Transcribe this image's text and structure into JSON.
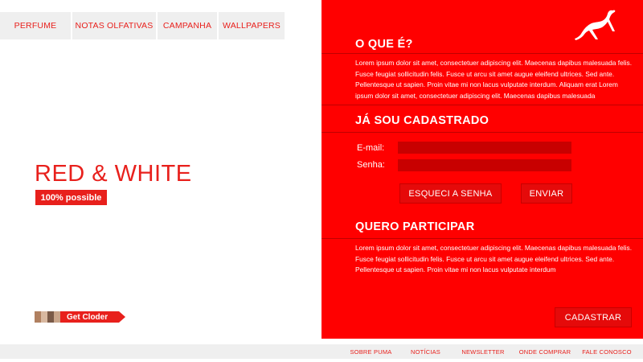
{
  "nav": {
    "items": [
      {
        "label": "PERFUME"
      },
      {
        "label": "NOTAS OLFATIVAS"
      },
      {
        "label": "CAMPANHA"
      },
      {
        "label": "WALLPAPERS"
      }
    ]
  },
  "hero": {
    "title": "RED & WHITE",
    "tagline": "100% possible"
  },
  "promo": {
    "label": "Get Cloder",
    "thumb_colors": [
      "#b08060",
      "#d8b8a0",
      "#7a5a48",
      "#c9a58a"
    ]
  },
  "panel": {
    "logo_icon": "puma-logo-icon",
    "about": {
      "title": "O QUE É?",
      "text": "Lorem ipsum dolor sit amet, consectetuer adipiscing elit. Maecenas dapibus malesuada felis. Fusce feugiat sollicitudin felis. Fusce ut arcu sit amet augue eleifend ultrices. Sed ante. Pellentesque ut sapien. Proin vitae mi non lacus  vulputate interdum. Aliquam erat Lorem ipsum dolor sit amet, consectetuer adipiscing elit. Maecenas dapibus malesuada"
    },
    "login": {
      "title": "JÁ SOU CADASTRADO",
      "email_label": "E-mail:",
      "email_value": "",
      "password_label": "Senha:",
      "password_value": "",
      "forgot_label": "ESQUECI A SENHA",
      "send_label": "ENVIAR"
    },
    "join": {
      "title": "QUERO PARTICIPAR",
      "text": "Lorem ipsum dolor sit amet, consectetuer adipiscing elit. Maecenas dapibus malesuada felis. Fusce feugiat sollicitudin felis. Fusce ut arcu sit amet augue eleifend ultrices. Sed ante. Pellentesque ut sapien. Proin vitae mi non lacus  vulputate interdum",
      "register_label": "CADASTRAR"
    }
  },
  "footer": {
    "links": [
      {
        "label": "SOBRE PUMA"
      },
      {
        "label": "NOTÍCIAS"
      },
      {
        "label": "NEWSLETTER"
      },
      {
        "label": "ONDE COMPRAR"
      },
      {
        "label": "FALE CONOSCO"
      }
    ]
  },
  "colors": {
    "brand_red": "#ff0000",
    "text_red": "#e8201c",
    "nav_bg": "#efefef"
  }
}
